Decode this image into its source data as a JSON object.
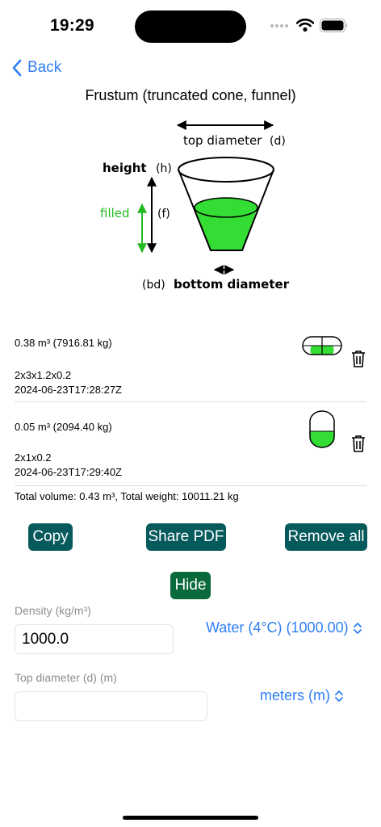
{
  "status": {
    "time": "19:29"
  },
  "nav": {
    "back_label": "Back"
  },
  "title": "Frustum (truncated cone, funnel)",
  "diagram": {
    "top_diameter": "top diameter",
    "top_diameter_symbol": "(d)",
    "height": "height",
    "height_symbol": "(h)",
    "filled": "filled",
    "filled_symbol": "(f)",
    "bottom_diameter": "bottom diameter",
    "bottom_diameter_symbol": "(bd)",
    "fill_color": "#33dd33"
  },
  "records": [
    {
      "summary": "0.38 m³ (7916.81 kg)",
      "dimensions": "2x3x1.2x0.2",
      "timestamp": "2024-06-23T17:28:27Z",
      "icon": "horizontal-tank-icon"
    },
    {
      "summary": "0.05 m³ (2094.40 kg)",
      "dimensions": "2x1x0.2",
      "timestamp": "2024-06-23T17:29:40Z",
      "icon": "vertical-tank-icon"
    }
  ],
  "total": "Total volume: 0.43 m³, Total weight: 10011.21 kg",
  "actions": {
    "copy": "Copy",
    "share_pdf": "Share PDF",
    "remove_all": "Remove all",
    "hide": "Hide"
  },
  "density": {
    "label": "Density (kg/m³)",
    "value": "1000.0",
    "material": "Water (4°C) (1000.00)"
  },
  "top_diameter": {
    "label": "Top diameter (d) (m)",
    "value": "",
    "unit": "meters (m)"
  },
  "colors": {
    "accent": "#2f7ff5",
    "button": "#065a5c",
    "hide_button": "#0a6a3c",
    "fill": "#33dd33"
  }
}
